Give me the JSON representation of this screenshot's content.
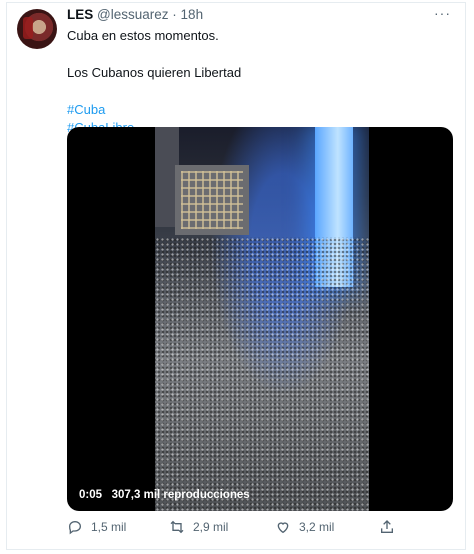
{
  "author": {
    "name": "LES",
    "handle": "@lessuarez",
    "separator": "·",
    "time": "18h"
  },
  "more_label": "···",
  "tweet": {
    "line1": "Cuba en estos momentos.",
    "line2": "Los Cubanos quieren Libertad",
    "hashtags": [
      "#Cuba",
      "#CubaLibre"
    ]
  },
  "video": {
    "elapsed": "0:05",
    "views": "307,3 mil reproducciones"
  },
  "actions": {
    "replies": "1,5 mil",
    "retweets": "2,9 mil",
    "likes": "3,2 mil"
  },
  "colors": {
    "link": "#1d9bf0",
    "secondary": "#536471"
  }
}
